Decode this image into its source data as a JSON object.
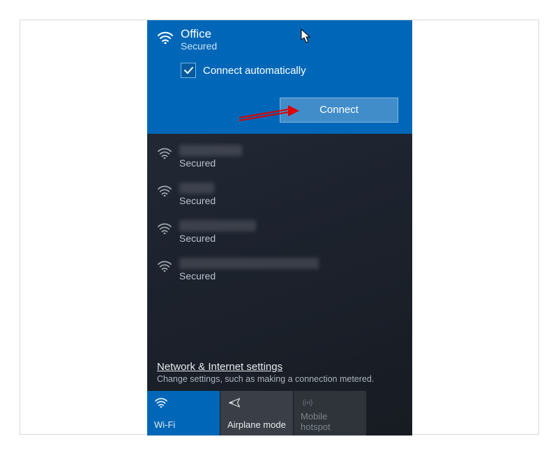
{
  "selected": {
    "name": "Office",
    "status": "Secured",
    "auto_label": "Connect automatically",
    "auto_checked": true,
    "connect_label": "Connect"
  },
  "networks": [
    {
      "name_blur_width": 90,
      "status": "Secured"
    },
    {
      "name_blur_width": 50,
      "status": "Secured"
    },
    {
      "name_blur_width": 110,
      "status": "Secured"
    },
    {
      "name_blur_width": 200,
      "status": "Secured"
    }
  ],
  "settings": {
    "title": "Network & Internet settings",
    "subtitle": "Change settings, such as making a connection metered."
  },
  "tiles": {
    "wifi": "Wi-Fi",
    "airplane": "Airplane mode",
    "hotspot": "Mobile hotspot"
  }
}
